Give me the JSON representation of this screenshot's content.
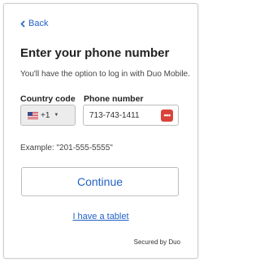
{
  "nav": {
    "back_label": "Back"
  },
  "header": {
    "title": "Enter your phone number",
    "subtitle": "You'll have the option to log in with Duo Mobile."
  },
  "form": {
    "country_label": "Country code",
    "country_value": "+1",
    "country_flag": "us-flag-icon",
    "phone_label": "Phone number",
    "phone_value": "713-743-1411",
    "example_text": "Example: \"201-555-5555\""
  },
  "actions": {
    "continue_label": "Continue",
    "tablet_link": "I have a tablet"
  },
  "footer": {
    "secured_text": "Secured by Duo"
  },
  "colors": {
    "accent": "#2262c6",
    "autofill_icon": "#d9433b",
    "select_bg": "#ececec"
  }
}
